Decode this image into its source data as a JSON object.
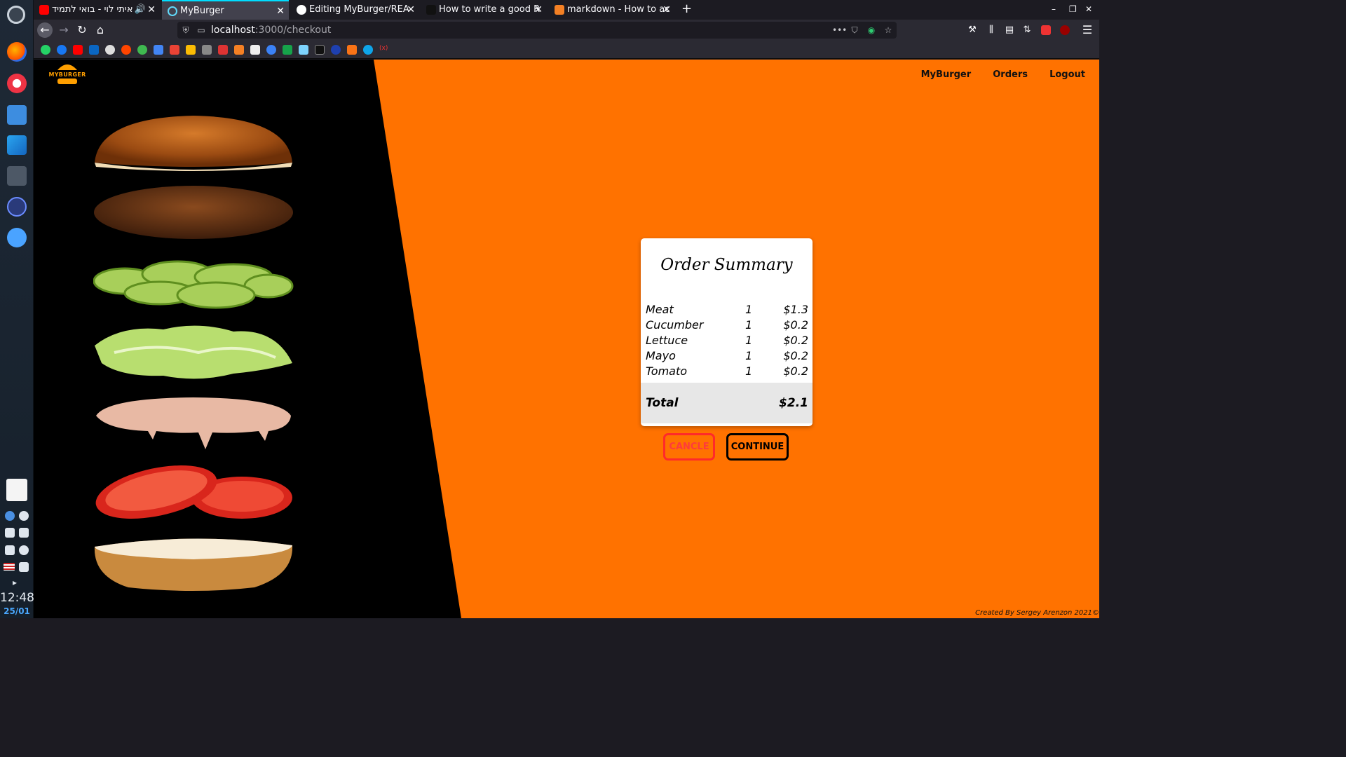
{
  "os": {
    "clock_time": "12:48",
    "clock_date": "25/01"
  },
  "browser": {
    "tabs": [
      {
        "label": "איתי לוי - בואי לתמיד",
        "active": false
      },
      {
        "label": "MyBurger",
        "active": true
      },
      {
        "label": "Editing MyBurger/REA",
        "active": false
      },
      {
        "label": "How to write a good R",
        "active": false
      },
      {
        "label": "markdown - How to ac",
        "active": false
      }
    ],
    "url_host": "localhost",
    "url_path": ":3000/checkout"
  },
  "app": {
    "logo_text": "MYBURGER",
    "nav": [
      {
        "label": "MyBurger"
      },
      {
        "label": "Orders"
      },
      {
        "label": "Logout"
      }
    ],
    "footer": "Created By Sergey Arenzon 2021©"
  },
  "order_summary": {
    "title": "Order Summary",
    "items": [
      {
        "name": "Meat",
        "qty": "1",
        "price": "$1.3"
      },
      {
        "name": "Cucumber",
        "qty": "1",
        "price": "$0.2"
      },
      {
        "name": "Lettuce",
        "qty": "1",
        "price": "$0.2"
      },
      {
        "name": "Mayo",
        "qty": "1",
        "price": "$0.2"
      },
      {
        "name": "Tomato",
        "qty": "1",
        "price": "$0.2"
      }
    ],
    "total_label": "Total",
    "total_value": "$2.1"
  },
  "actions": {
    "cancel_label": "CANCLE",
    "continue_label": "CONTINUE"
  },
  "colors": {
    "accent": "#ff7200",
    "cancel": "#ff2a2a"
  }
}
